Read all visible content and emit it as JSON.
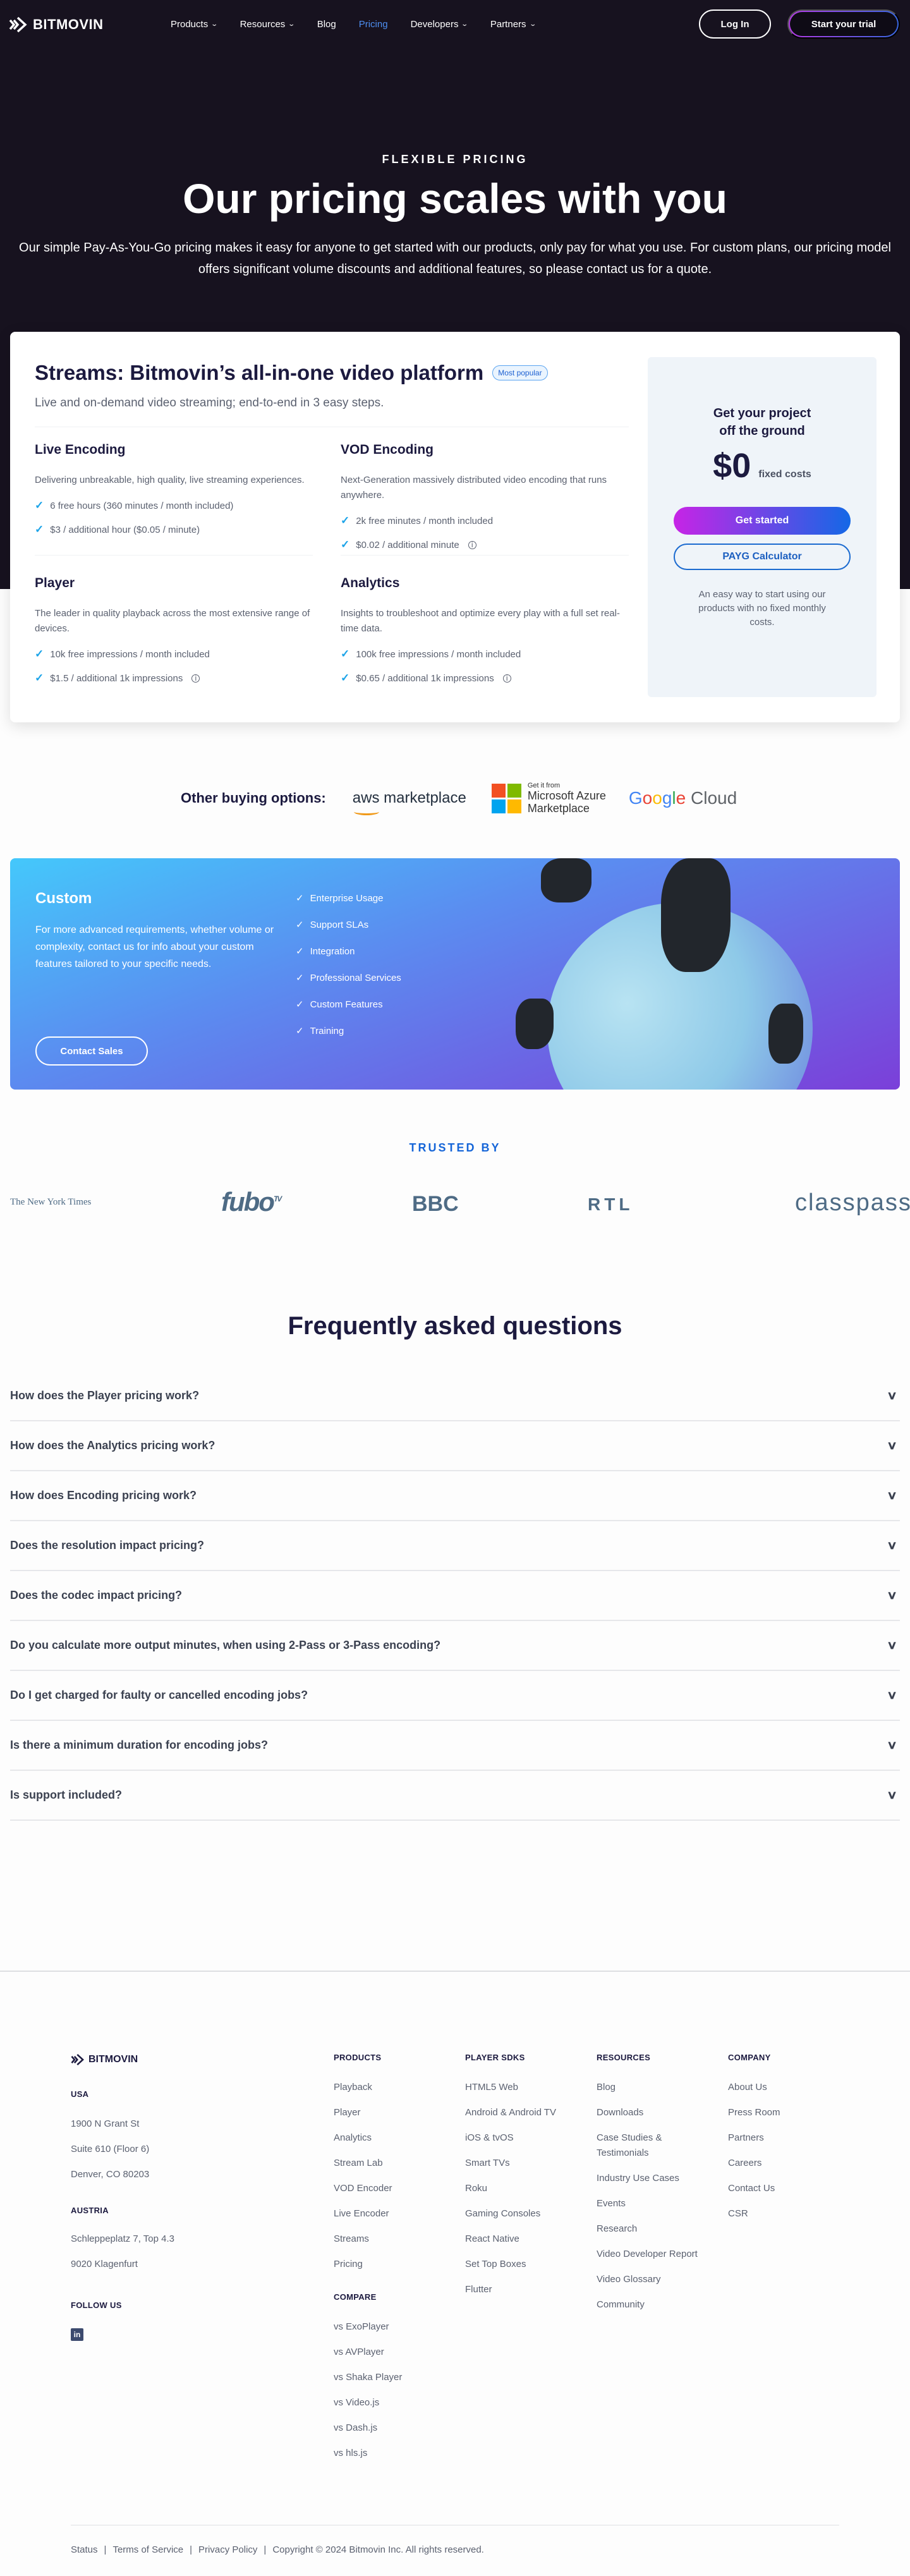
{
  "nav": {
    "brand": "BITMOVIN",
    "links": [
      {
        "label": "Products",
        "dropdown": true
      },
      {
        "label": "Resources",
        "dropdown": true
      },
      {
        "label": "Blog",
        "dropdown": false
      },
      {
        "label": "Pricing",
        "dropdown": false,
        "active": true
      },
      {
        "label": "Developers",
        "dropdown": true
      },
      {
        "label": "Partners",
        "dropdown": true
      }
    ],
    "login_label": "Log In",
    "trial_label": "Start your trial"
  },
  "hero": {
    "eyebrow": "FLEXIBLE PRICING",
    "title": "Our pricing scales with you",
    "subtitle": "Our simple Pay-As-You-Go pricing makes it easy for anyone to get started with our products, only pay for what you use. For custom plans, our pricing model offers significant volume discounts and additional features, so please contact us for a quote."
  },
  "pricing": {
    "title": "Streams: Bitmovin’s all-in-one video platform",
    "badge": "Most popular",
    "subtitle": "Live and on-demand video streaming; end-to-end in 3 easy steps.",
    "products": [
      {
        "name": "Live Encoding",
        "desc": "Delivering unbreakable, high quality, live streaming experiences.",
        "features": [
          "6 free hours (360 minutes / month included)",
          "$3 / additional hour ($0.05 / minute)"
        ]
      },
      {
        "name": "VOD Encoding",
        "desc": "Next-Generation massively distributed video encoding that runs anywhere.",
        "features": [
          "2k free minutes / month included",
          "$0.02 / additional minute"
        ]
      },
      {
        "name": "Player",
        "desc": "The leader in quality playback across the most extensive range of devices.",
        "features": [
          "10k free impressions / month included",
          "$1.5 / additional 1k impressions"
        ]
      },
      {
        "name": "Analytics",
        "desc": "Insights to troubleshoot and optimize every play with a full set real-time data.",
        "features": [
          "100k free impressions / month included",
          "$0.65 / additional 1k impressions"
        ]
      }
    ],
    "side": {
      "heading_line1": "Get your project",
      "heading_line2": "off the ground",
      "price": "$0",
      "price_label": "fixed costs",
      "get_started": "Get started",
      "calculator": "PAYG Calculator",
      "note": "An easy way to start using our products with no fixed monthly costs."
    }
  },
  "buying": {
    "label": "Other buying options:",
    "aws": "aws marketplace",
    "azure_small": "Get it from",
    "azure_line1": "Microsoft Azure",
    "azure_line2": "Marketplace",
    "google": "Google Cloud"
  },
  "custom": {
    "title": "Custom",
    "desc": "For more advanced requirements, whether volume or complexity, contact us for info about your custom features tailored to your specific needs.",
    "button": "Contact Sales",
    "features": [
      "Enterprise Usage",
      "Support SLAs",
      "Integration",
      "Professional Services",
      "Custom Features",
      "Training"
    ]
  },
  "trusted": {
    "label": "TRUSTED BY",
    "logos": [
      "The New York Times",
      "fubo",
      "BBC",
      "RTL",
      "classpass"
    ],
    "fubo_sup": "TV"
  },
  "faq": {
    "title": "Frequently asked questions",
    "items": [
      "How does the Player pricing work?",
      "How does the Analytics pricing work?",
      "How does Encoding pricing work?",
      "Does the resolution impact pricing?",
      "Does the codec impact pricing?",
      "Do you calculate more output minutes, when using 2-Pass or 3-Pass encoding?",
      "Do I get charged for faulty or cancelled encoding jobs?",
      "Is there a minimum duration for encoding jobs?",
      "Is support included?"
    ]
  },
  "footer": {
    "brand": "BITMOVIN",
    "usa_label": "USA",
    "usa_lines": [
      "1900 N Grant St",
      "Suite 610 (Floor 6)",
      "Denver, CO 80203"
    ],
    "austria_label": "AUSTRIA",
    "austria_lines": [
      "Schleppeplatz 7, Top 4.3",
      "9020 Klagenfurt"
    ],
    "follow_label": "FOLLOW US",
    "products": {
      "heading": "PRODUCTS",
      "links": [
        "Playback",
        "Player",
        "Analytics",
        "Stream Lab",
        "VOD Encoder",
        "Live Encoder",
        "Streams",
        "Pricing"
      ]
    },
    "compare": {
      "heading": "COMPARE",
      "links": [
        "vs ExoPlayer",
        "vs AVPlayer",
        "vs Shaka Player",
        "vs Video.js",
        "vs Dash.js",
        "vs hls.js"
      ]
    },
    "sdks": {
      "heading": "PLAYER SDKS",
      "links": [
        "HTML5 Web",
        "Android & Android TV",
        "iOS & tvOS",
        "Smart TVs",
        "Roku",
        "Gaming Consoles",
        "React Native",
        "Set Top Boxes",
        "Flutter"
      ]
    },
    "resources": {
      "heading": "RESOURCES",
      "links": [
        "Blog",
        "Downloads",
        "Case Studies & Testimonials",
        "Industry Use Cases",
        "Events",
        "Research",
        "Video Developer Report",
        "Video Glossary",
        "Community"
      ]
    },
    "company": {
      "heading": "COMPANY",
      "links": [
        "About Us",
        "Press Room",
        "Partners",
        "Careers",
        "Contact Us",
        "CSR"
      ]
    },
    "bottom": {
      "status": "Status",
      "terms": "Terms of Service",
      "privacy": "Privacy Policy",
      "copyright": "Copyright © 2024 Bitmovin Inc. All rights reserved."
    }
  }
}
